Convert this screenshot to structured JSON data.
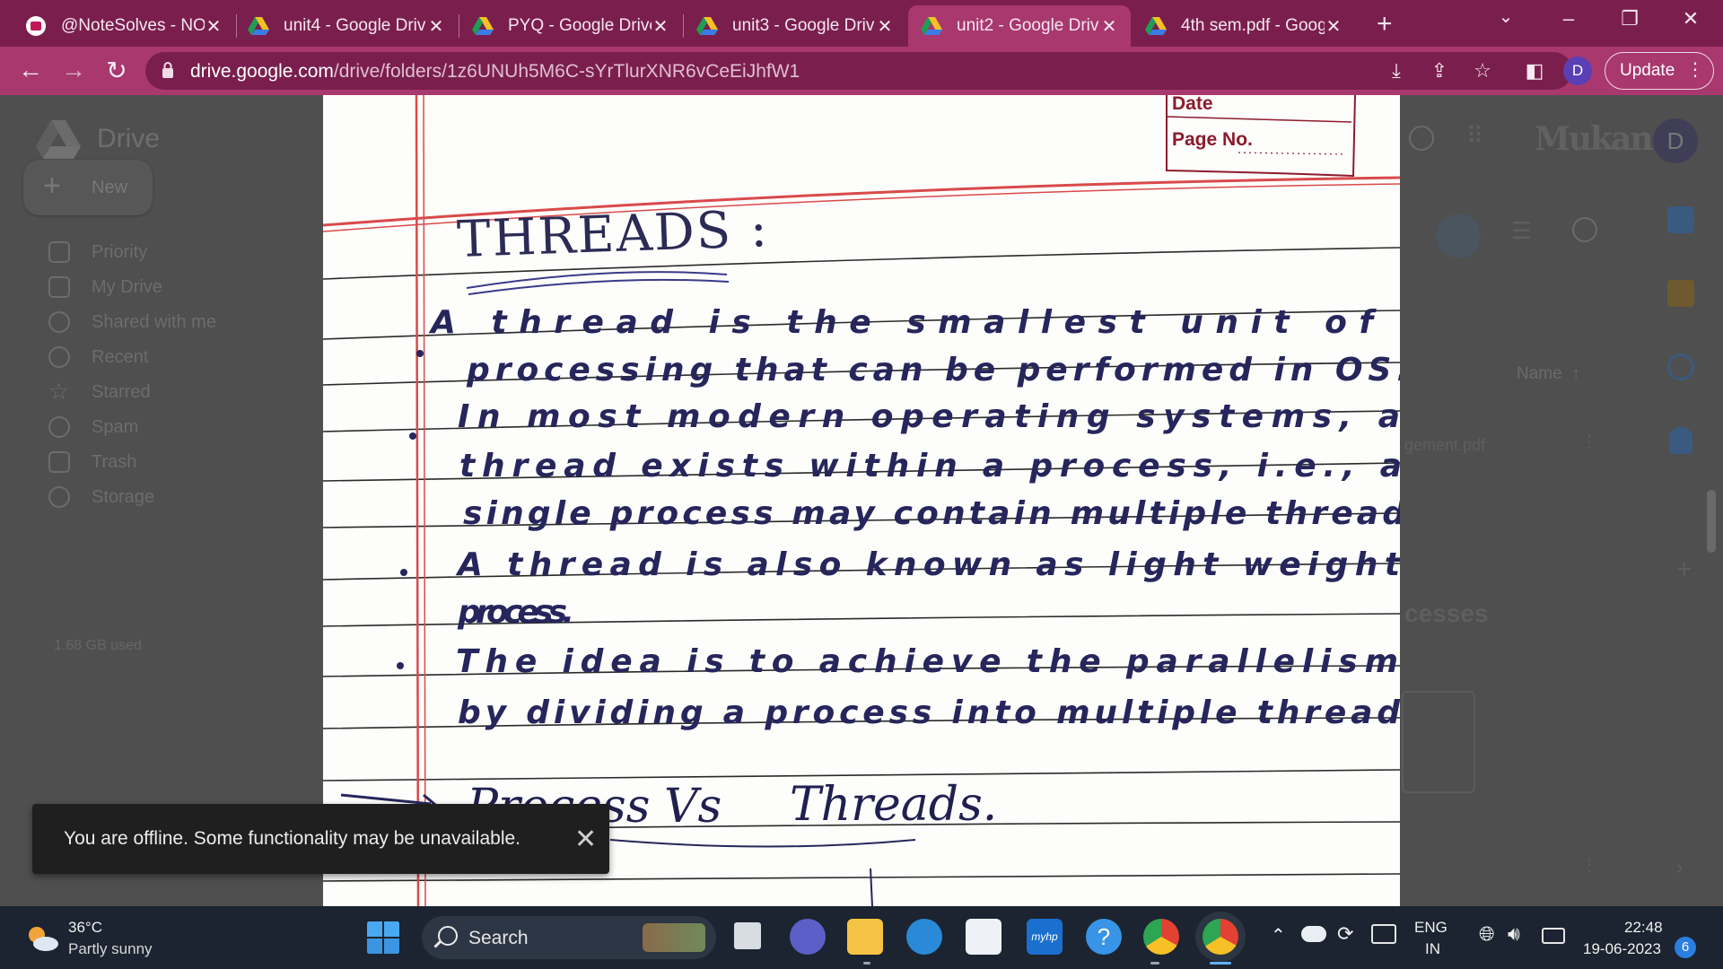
{
  "browser": {
    "tabs": [
      {
        "title": "@NoteSolves - NO",
        "favicon": "notesolves-icon"
      },
      {
        "title": "unit4 - Google Driv",
        "favicon": "google-drive-icon"
      },
      {
        "title": "PYQ - Google Drive",
        "favicon": "google-drive-icon"
      },
      {
        "title": "unit3 - Google Driv",
        "favicon": "google-drive-icon"
      },
      {
        "title": "unit2 - Google Driv",
        "favicon": "google-drive-icon",
        "active": true
      },
      {
        "title": "4th sem.pdf - Goog",
        "favicon": "google-drive-icon"
      }
    ],
    "url_host": "drive.google.com",
    "url_path": "/drive/folders/1z6UNUh5M6C-sYrTlurXNR6vCeEiJhfW1",
    "profile_initial": "D",
    "update_label": "Update",
    "theme_colors": {
      "frame": "#7a1f4d",
      "toolbar": "#a8386e"
    }
  },
  "drive": {
    "app_name": "Drive",
    "new_label": "New",
    "nav": [
      "Priority",
      "My Drive",
      "Shared with me",
      "Recent",
      "Starred",
      "Spam",
      "Trash",
      "Storage"
    ],
    "storage_used": "1.68 GB used",
    "account_brand": "Mukand",
    "avatar_initial": "D",
    "sort_label": "Name",
    "partial_file": "gement.pdf",
    "partial_heading": "cesses"
  },
  "notes": {
    "stamp": {
      "date_label": "Date",
      "page_label": "Page No."
    },
    "title": "THREADS :",
    "lines": [
      "A  thread  is  the  smallest  unit  of",
      "processing  that  can  be  performed  in  OS.",
      "In  most  modern  operating  systems,  a",
      "thread  exists  within  a  process,  i.e.,  a",
      "single  process  may  contain  multiple  thread",
      "A  thread  is  also  known  as  light weight",
      "process.",
      "The  idea  is  to  achieve  the  parallelism",
      "by  dividing  a  process  into  multiple  thread"
    ],
    "subheading_left": "Process",
    "subheading_vs": "Vs",
    "subheading_right": "Threads.",
    "ink_color": "#26265c"
  },
  "toast": {
    "message": "You are offline. Some functionality may be unavailable."
  },
  "taskbar": {
    "temperature": "36°C",
    "condition": "Partly sunny",
    "search_label": "Search",
    "language_top": "ENG",
    "language_bottom": "IN",
    "time": "22:48",
    "date": "19-06-2023",
    "notification_count": "6",
    "myhp_label": "myhp"
  }
}
